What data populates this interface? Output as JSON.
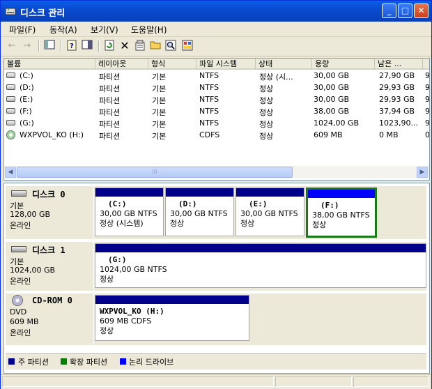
{
  "window": {
    "title": "디스크 관리"
  },
  "menu": [
    {
      "label": "파일(F)"
    },
    {
      "label": "동작(A)"
    },
    {
      "label": "보기(V)"
    },
    {
      "label": "도움말(H)"
    }
  ],
  "toolbar": {
    "icons": [
      "back-arrow-icon",
      "forward-arrow-icon",
      "show-hide-console-tree-icon",
      "help-icon",
      "properties-pane-icon",
      "refresh-icon",
      "delete-icon",
      "properties-icon",
      "open-folder-icon",
      "search-icon",
      "export-icon"
    ]
  },
  "list": {
    "columns": [
      "볼륨",
      "레이아웃",
      "형식",
      "파일 시스템",
      "상태",
      "용량",
      "남은 ..."
    ],
    "rows": [
      {
        "volume": "(C:)",
        "layout": "파티션",
        "type": "기본",
        "fs": "NTFS",
        "status": "정상 (시...",
        "capacity": "30,00 GB",
        "free": "27,90 GB",
        "more": "9",
        "icon": "disk"
      },
      {
        "volume": "(D:)",
        "layout": "파티션",
        "type": "기본",
        "fs": "NTFS",
        "status": "정상",
        "capacity": "30,00 GB",
        "free": "29,93 GB",
        "more": "9",
        "icon": "disk"
      },
      {
        "volume": "(E:)",
        "layout": "파티션",
        "type": "기본",
        "fs": "NTFS",
        "status": "정상",
        "capacity": "30,00 GB",
        "free": "29,93 GB",
        "more": "9",
        "icon": "disk"
      },
      {
        "volume": "(F:)",
        "layout": "파티션",
        "type": "기본",
        "fs": "NTFS",
        "status": "정상",
        "capacity": "38,00 GB",
        "free": "37,94 GB",
        "more": "9",
        "icon": "disk"
      },
      {
        "volume": "(G:)",
        "layout": "파티션",
        "type": "기본",
        "fs": "NTFS",
        "status": "정상",
        "capacity": "1024,00 GB",
        "free": "1023,90...",
        "more": "9",
        "icon": "disk"
      },
      {
        "volume": "WXPVOL_KO (H:)",
        "layout": "파티션",
        "type": "기본",
        "fs": "CDFS",
        "status": "정상",
        "capacity": "609 MB",
        "free": "0 MB",
        "more": "0",
        "icon": "cd"
      }
    ],
    "scroll_thumb_glyph": "III"
  },
  "disks": [
    {
      "name": "디스크 0",
      "kind": "기본",
      "size": "128,00 GB",
      "state": "온라인",
      "volumes": [
        {
          "label": "(C:)",
          "line1": "30,00 GB NTFS",
          "line2": "정상 (시스템)"
        },
        {
          "label": "(D:)",
          "line1": "30,00 GB NTFS",
          "line2": "정상"
        },
        {
          "label": "(E:)",
          "line1": "30,00 GB NTFS",
          "line2": "정상"
        },
        {
          "label": "(F:)",
          "line1": "38,00 GB NTFS",
          "line2": "정상"
        }
      ]
    },
    {
      "name": "디스크 1",
      "kind": "기본",
      "size": "1024,00 GB",
      "state": "온라인",
      "volumes": [
        {
          "label": "(G:)",
          "line1": "1024,00 GB NTFS",
          "line2": "정상"
        }
      ]
    },
    {
      "name": "CD-ROM 0",
      "kind": "DVD",
      "size": "609 MB",
      "state": "온라인",
      "volumes": [
        {
          "label": "WXPVOL_KO  (H:)",
          "line1": "609 MB CDFS",
          "line2": "정상"
        }
      ]
    }
  ],
  "legend": [
    {
      "label": "주 파티션",
      "color": "#00008b"
    },
    {
      "label": "확장 파티션",
      "color": "#008000"
    },
    {
      "label": "논리 드라이브",
      "color": "#0000ff"
    }
  ],
  "colors": {
    "primary_partition": "#00008b",
    "logical_drive": "#0000ff",
    "selection": "#1a7a1a"
  }
}
